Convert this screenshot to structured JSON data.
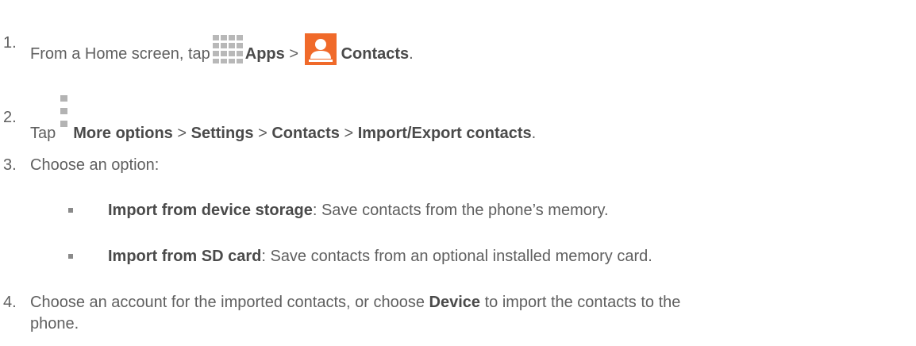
{
  "steps": [
    {
      "number": "1.",
      "lead": "From a Home screen, tap",
      "apps_label": "Apps",
      "sep": ">",
      "contacts_label": "Contacts",
      "end": "."
    },
    {
      "number": "2.",
      "lead": "Tap",
      "more_options": "More options",
      "sep1": ">",
      "settings": "Settings",
      "sep2": ">",
      "contacts": "Contacts",
      "sep3": ">",
      "import_export": "Import/Export contacts",
      "end": "."
    },
    {
      "number": "3.",
      "text": "Choose an option:"
    },
    {
      "number": "4.",
      "lead": "Choose an account for the imported contacts, or choose",
      "device": "Device",
      "tail": "to import the contacts to the",
      "wrap": "phone."
    }
  ],
  "options": [
    {
      "title": "Import from device storage",
      "desc": ": Save contacts from the phone’s memory."
    },
    {
      "title": "Import from SD card",
      "desc": ": Save contacts from an optional installed memory card."
    }
  ],
  "icons": {
    "apps": "apps-grid-icon",
    "contacts": "contacts-icon",
    "more": "more-options-icon"
  },
  "colors": {
    "text": "#5f5f5f",
    "bold": "#4a4a4a",
    "apps_icon": "#b8b8b8",
    "contacts_icon": "#f06a2a"
  }
}
